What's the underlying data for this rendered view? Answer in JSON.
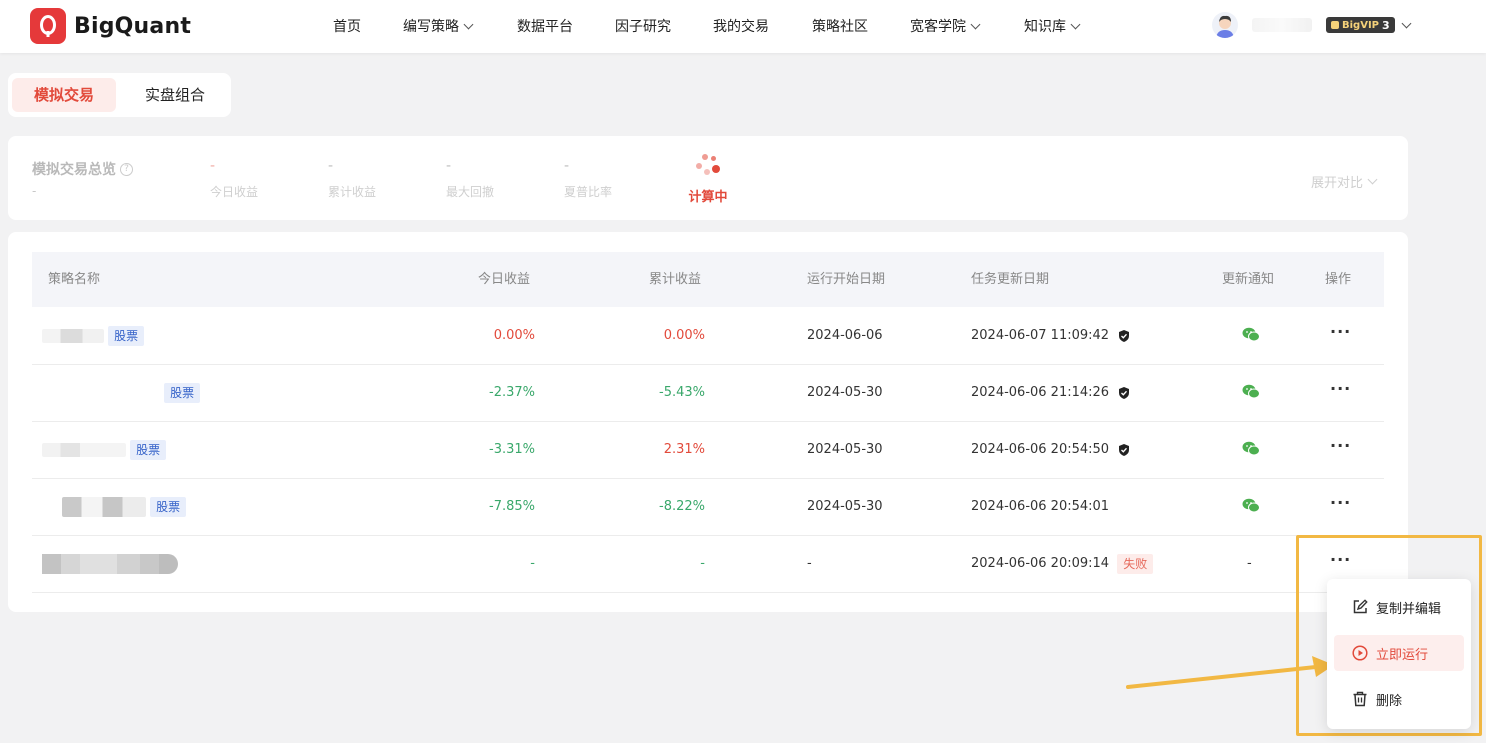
{
  "brand": {
    "name": "BigQuant",
    "logo_letter": "Q",
    "accent": "#e5393a"
  },
  "nav": {
    "items": [
      {
        "label": "首页",
        "has_dropdown": false
      },
      {
        "label": "编写策略",
        "has_dropdown": true
      },
      {
        "label": "数据平台",
        "has_dropdown": false
      },
      {
        "label": "因子研究",
        "has_dropdown": false
      },
      {
        "label": "我的交易",
        "has_dropdown": false
      },
      {
        "label": "策略社区",
        "has_dropdown": false
      },
      {
        "label": "宽客学院",
        "has_dropdown": true
      },
      {
        "label": "知识库",
        "has_dropdown": true
      }
    ],
    "vip_label": "BigVIP",
    "vip_level": "3"
  },
  "tabs": {
    "active": "模拟交易",
    "inactive": "实盘组合"
  },
  "overview": {
    "title": "模拟交易总览",
    "subtitle": "-",
    "metrics": [
      {
        "value": "-",
        "label": "今日收益"
      },
      {
        "value": "-",
        "label": "累计收益"
      },
      {
        "value": "-",
        "label": "最大回撤"
      },
      {
        "value": "-",
        "label": "夏普比率"
      }
    ],
    "status": "计算中",
    "expand_label": "展开对比"
  },
  "table": {
    "headers": {
      "name": "策略名称",
      "today": "今日收益",
      "total": "累计收益",
      "start": "运行开始日期",
      "updated": "任务更新日期",
      "notify": "更新通知",
      "ops": "操作"
    },
    "rows": [
      {
        "tag": "股票",
        "today": "0.00%",
        "total": "0.00%",
        "start": "2024-06-06",
        "updated": "2024-06-07 11:09:42",
        "notify": "wechat",
        "verified": true,
        "fail": ""
      },
      {
        "tag": "股票",
        "today": "-2.37%",
        "total": "-5.43%",
        "start": "2024-05-30",
        "updated": "2024-06-06 21:14:26",
        "notify": "wechat",
        "verified": true,
        "fail": ""
      },
      {
        "tag": "股票",
        "today": "-3.31%",
        "total": "2.31%",
        "start": "2024-05-30",
        "updated": "2024-06-06 20:54:50",
        "notify": "wechat",
        "verified": true,
        "fail": ""
      },
      {
        "tag": "股票",
        "today": "-7.85%",
        "total": "-8.22%",
        "start": "2024-05-30",
        "updated": "2024-06-06 20:54:01",
        "notify": "wechat",
        "verified": false,
        "fail": ""
      },
      {
        "tag": "",
        "today": "-",
        "total": "-",
        "start": "-",
        "updated": "2024-06-06 20:09:14",
        "notify": "-",
        "verified": false,
        "fail": "失败"
      }
    ],
    "more_label": "···"
  },
  "menu": {
    "items": [
      {
        "label": "复制并编辑",
        "icon": "edit-icon"
      },
      {
        "label": "立即运行",
        "icon": "play-circle-icon",
        "active": true
      },
      {
        "label": "删除",
        "icon": "trash-icon"
      }
    ]
  },
  "colors": {
    "positive": "#e24a3b",
    "negative": "#3aa86b",
    "highlight": "#f2b843"
  }
}
